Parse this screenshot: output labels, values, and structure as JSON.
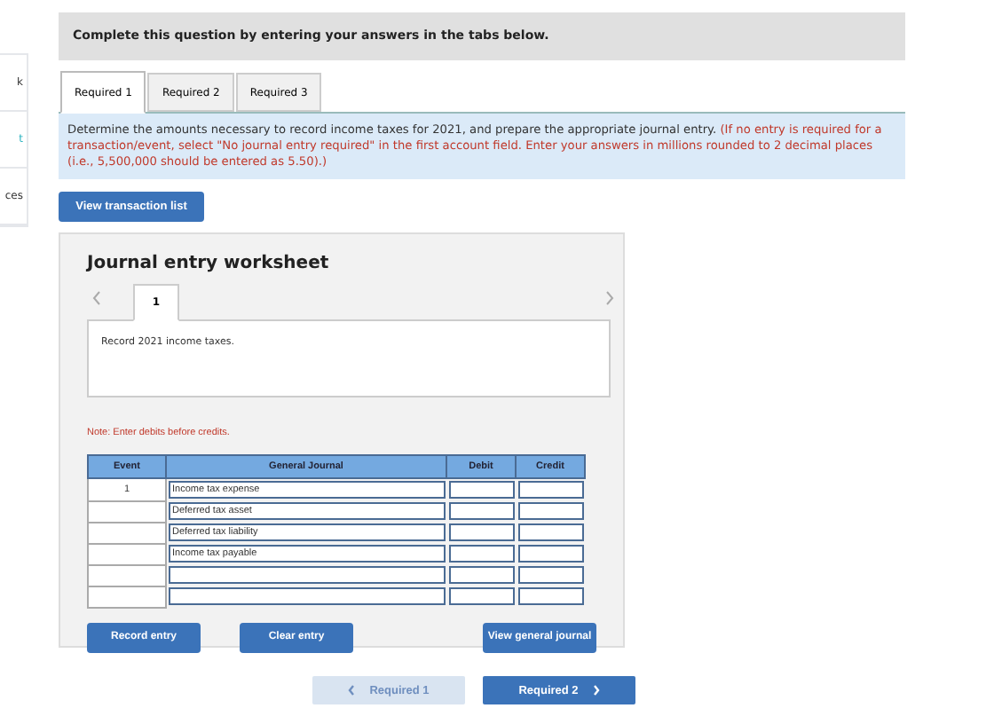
{
  "sidebar": {
    "items": [
      "k",
      "t",
      "ces"
    ]
  },
  "header": "Complete this question by entering your answers in the tabs below.",
  "tabs": [
    {
      "label": "Required 1",
      "selected": true
    },
    {
      "label": "Required 2",
      "selected": false
    },
    {
      "label": "Required 3",
      "selected": false
    }
  ],
  "instructions": {
    "text": "Determine the amounts necessary to record income taxes for 2021, and prepare the appropriate journal entry.",
    "note": "(If no entry is required for a transaction/event, select \"No journal entry required\" in the first account field. Enter your answers in millions rounded to 2 decimal places (i.e., 5,500,000 should be entered as 5.50).)"
  },
  "view_transaction_button": "View transaction list",
  "worksheet": {
    "title": "Journal entry worksheet",
    "pages": [
      {
        "label": "1",
        "selected": true
      }
    ],
    "description": "Record 2021 income taxes.",
    "note": "Note: Enter debits before credits.",
    "table": {
      "columns": [
        "Event",
        "General Journal",
        "Debit",
        "Credit"
      ],
      "rows": [
        {
          "event": "1",
          "account": "Income tax expense"
        },
        {
          "account": "Deferred tax asset"
        },
        {
          "account": "Deferred tax liability"
        },
        {
          "account": "Income tax payable"
        },
        {},
        {}
      ]
    },
    "buttons": [
      "Record entry",
      "Clear entry",
      "View general journal"
    ]
  },
  "footer_nav": [
    {
      "label": "Required 1",
      "disabled": true,
      "kind": "prev"
    },
    {
      "label": "Required 2",
      "disabled": false,
      "kind": "next"
    }
  ]
}
